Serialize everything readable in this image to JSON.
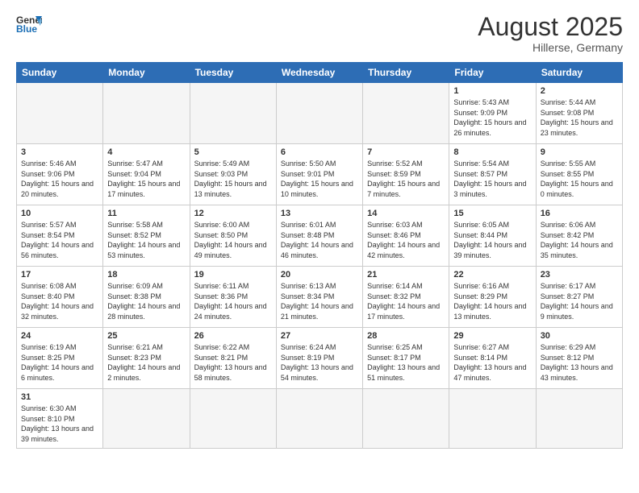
{
  "header": {
    "logo_general": "General",
    "logo_blue": "Blue",
    "month_year": "August 2025",
    "location": "Hillerse, Germany"
  },
  "weekdays": [
    "Sunday",
    "Monday",
    "Tuesday",
    "Wednesday",
    "Thursday",
    "Friday",
    "Saturday"
  ],
  "weeks": [
    [
      {
        "day": "",
        "info": ""
      },
      {
        "day": "",
        "info": ""
      },
      {
        "day": "",
        "info": ""
      },
      {
        "day": "",
        "info": ""
      },
      {
        "day": "",
        "info": ""
      },
      {
        "day": "1",
        "info": "Sunrise: 5:43 AM\nSunset: 9:09 PM\nDaylight: 15 hours and 26 minutes."
      },
      {
        "day": "2",
        "info": "Sunrise: 5:44 AM\nSunset: 9:08 PM\nDaylight: 15 hours and 23 minutes."
      }
    ],
    [
      {
        "day": "3",
        "info": "Sunrise: 5:46 AM\nSunset: 9:06 PM\nDaylight: 15 hours and 20 minutes."
      },
      {
        "day": "4",
        "info": "Sunrise: 5:47 AM\nSunset: 9:04 PM\nDaylight: 15 hours and 17 minutes."
      },
      {
        "day": "5",
        "info": "Sunrise: 5:49 AM\nSunset: 9:03 PM\nDaylight: 15 hours and 13 minutes."
      },
      {
        "day": "6",
        "info": "Sunrise: 5:50 AM\nSunset: 9:01 PM\nDaylight: 15 hours and 10 minutes."
      },
      {
        "day": "7",
        "info": "Sunrise: 5:52 AM\nSunset: 8:59 PM\nDaylight: 15 hours and 7 minutes."
      },
      {
        "day": "8",
        "info": "Sunrise: 5:54 AM\nSunset: 8:57 PM\nDaylight: 15 hours and 3 minutes."
      },
      {
        "day": "9",
        "info": "Sunrise: 5:55 AM\nSunset: 8:55 PM\nDaylight: 15 hours and 0 minutes."
      }
    ],
    [
      {
        "day": "10",
        "info": "Sunrise: 5:57 AM\nSunset: 8:54 PM\nDaylight: 14 hours and 56 minutes."
      },
      {
        "day": "11",
        "info": "Sunrise: 5:58 AM\nSunset: 8:52 PM\nDaylight: 14 hours and 53 minutes."
      },
      {
        "day": "12",
        "info": "Sunrise: 6:00 AM\nSunset: 8:50 PM\nDaylight: 14 hours and 49 minutes."
      },
      {
        "day": "13",
        "info": "Sunrise: 6:01 AM\nSunset: 8:48 PM\nDaylight: 14 hours and 46 minutes."
      },
      {
        "day": "14",
        "info": "Sunrise: 6:03 AM\nSunset: 8:46 PM\nDaylight: 14 hours and 42 minutes."
      },
      {
        "day": "15",
        "info": "Sunrise: 6:05 AM\nSunset: 8:44 PM\nDaylight: 14 hours and 39 minutes."
      },
      {
        "day": "16",
        "info": "Sunrise: 6:06 AM\nSunset: 8:42 PM\nDaylight: 14 hours and 35 minutes."
      }
    ],
    [
      {
        "day": "17",
        "info": "Sunrise: 6:08 AM\nSunset: 8:40 PM\nDaylight: 14 hours and 32 minutes."
      },
      {
        "day": "18",
        "info": "Sunrise: 6:09 AM\nSunset: 8:38 PM\nDaylight: 14 hours and 28 minutes."
      },
      {
        "day": "19",
        "info": "Sunrise: 6:11 AM\nSunset: 8:36 PM\nDaylight: 14 hours and 24 minutes."
      },
      {
        "day": "20",
        "info": "Sunrise: 6:13 AM\nSunset: 8:34 PM\nDaylight: 14 hours and 21 minutes."
      },
      {
        "day": "21",
        "info": "Sunrise: 6:14 AM\nSunset: 8:32 PM\nDaylight: 14 hours and 17 minutes."
      },
      {
        "day": "22",
        "info": "Sunrise: 6:16 AM\nSunset: 8:29 PM\nDaylight: 14 hours and 13 minutes."
      },
      {
        "day": "23",
        "info": "Sunrise: 6:17 AM\nSunset: 8:27 PM\nDaylight: 14 hours and 9 minutes."
      }
    ],
    [
      {
        "day": "24",
        "info": "Sunrise: 6:19 AM\nSunset: 8:25 PM\nDaylight: 14 hours and 6 minutes."
      },
      {
        "day": "25",
        "info": "Sunrise: 6:21 AM\nSunset: 8:23 PM\nDaylight: 14 hours and 2 minutes."
      },
      {
        "day": "26",
        "info": "Sunrise: 6:22 AM\nSunset: 8:21 PM\nDaylight: 13 hours and 58 minutes."
      },
      {
        "day": "27",
        "info": "Sunrise: 6:24 AM\nSunset: 8:19 PM\nDaylight: 13 hours and 54 minutes."
      },
      {
        "day": "28",
        "info": "Sunrise: 6:25 AM\nSunset: 8:17 PM\nDaylight: 13 hours and 51 minutes."
      },
      {
        "day": "29",
        "info": "Sunrise: 6:27 AM\nSunset: 8:14 PM\nDaylight: 13 hours and 47 minutes."
      },
      {
        "day": "30",
        "info": "Sunrise: 6:29 AM\nSunset: 8:12 PM\nDaylight: 13 hours and 43 minutes."
      }
    ],
    [
      {
        "day": "31",
        "info": "Sunrise: 6:30 AM\nSunset: 8:10 PM\nDaylight: 13 hours and 39 minutes."
      },
      {
        "day": "",
        "info": ""
      },
      {
        "day": "",
        "info": ""
      },
      {
        "day": "",
        "info": ""
      },
      {
        "day": "",
        "info": ""
      },
      {
        "day": "",
        "info": ""
      },
      {
        "day": "",
        "info": ""
      }
    ]
  ]
}
